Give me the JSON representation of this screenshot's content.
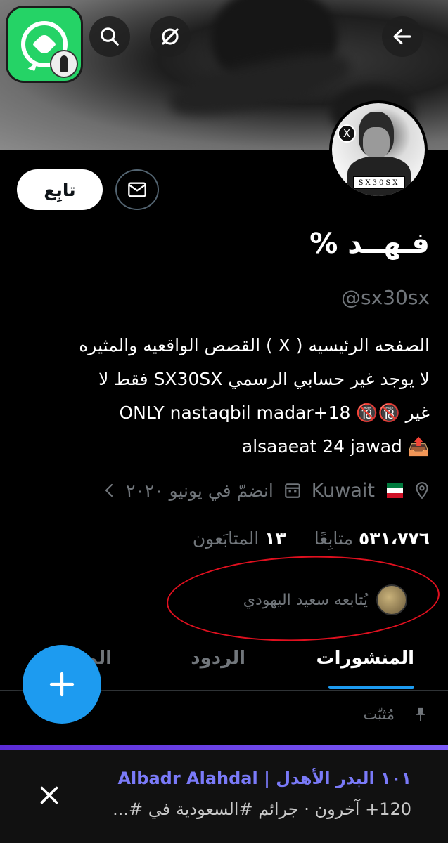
{
  "profile": {
    "follow_label": "تابِع",
    "name": "فـهــد %",
    "handle": "@sx30sx",
    "bio_lines": [
      "الصفحه الرئيسيه ( X ) القصص الواقعيه والمثيره",
      "لا يوجد غير حسابي الرسمي SX30SX فقط لا",
      "غير 🔞🔞 ONLY nastaqbil madar+18",
      "📤 alsaaeat 24 jawad"
    ],
    "avatar_tag": "SX30SX",
    "location": "Kuwait",
    "joined": "انضمّ في يونيو ٢٠٢٠",
    "following_count": "١٣",
    "following_label": "المتابَعون",
    "followers_count": "٥٣١،٧٧٦",
    "followers_label": "متابِعًا",
    "followed_by": "يُتابعه سعيد اليهودي"
  },
  "tabs": [
    {
      "label": "المنشورات",
      "active": true
    },
    {
      "label": "الردود",
      "active": false
    },
    {
      "label": "المـ",
      "active": false
    }
  ],
  "pinned_label": "مُثبّت",
  "notification": {
    "title": "١٠١ البدر الأهدل | Albadr Alahdal",
    "subtitle": "120+ آخرون · جرائم #السعودية في #..."
  },
  "colors": {
    "accent": "#1d9bf0",
    "annotation": "#e0101f",
    "whatsapp": "#25d366"
  },
  "icons": [
    "whatsapp-icon",
    "search-icon",
    "no-location-icon",
    "back-arrow-icon",
    "mail-icon",
    "location-pin-icon",
    "calendar-icon",
    "chevron-left-icon",
    "pin-icon",
    "plus-icon",
    "close-icon"
  ]
}
